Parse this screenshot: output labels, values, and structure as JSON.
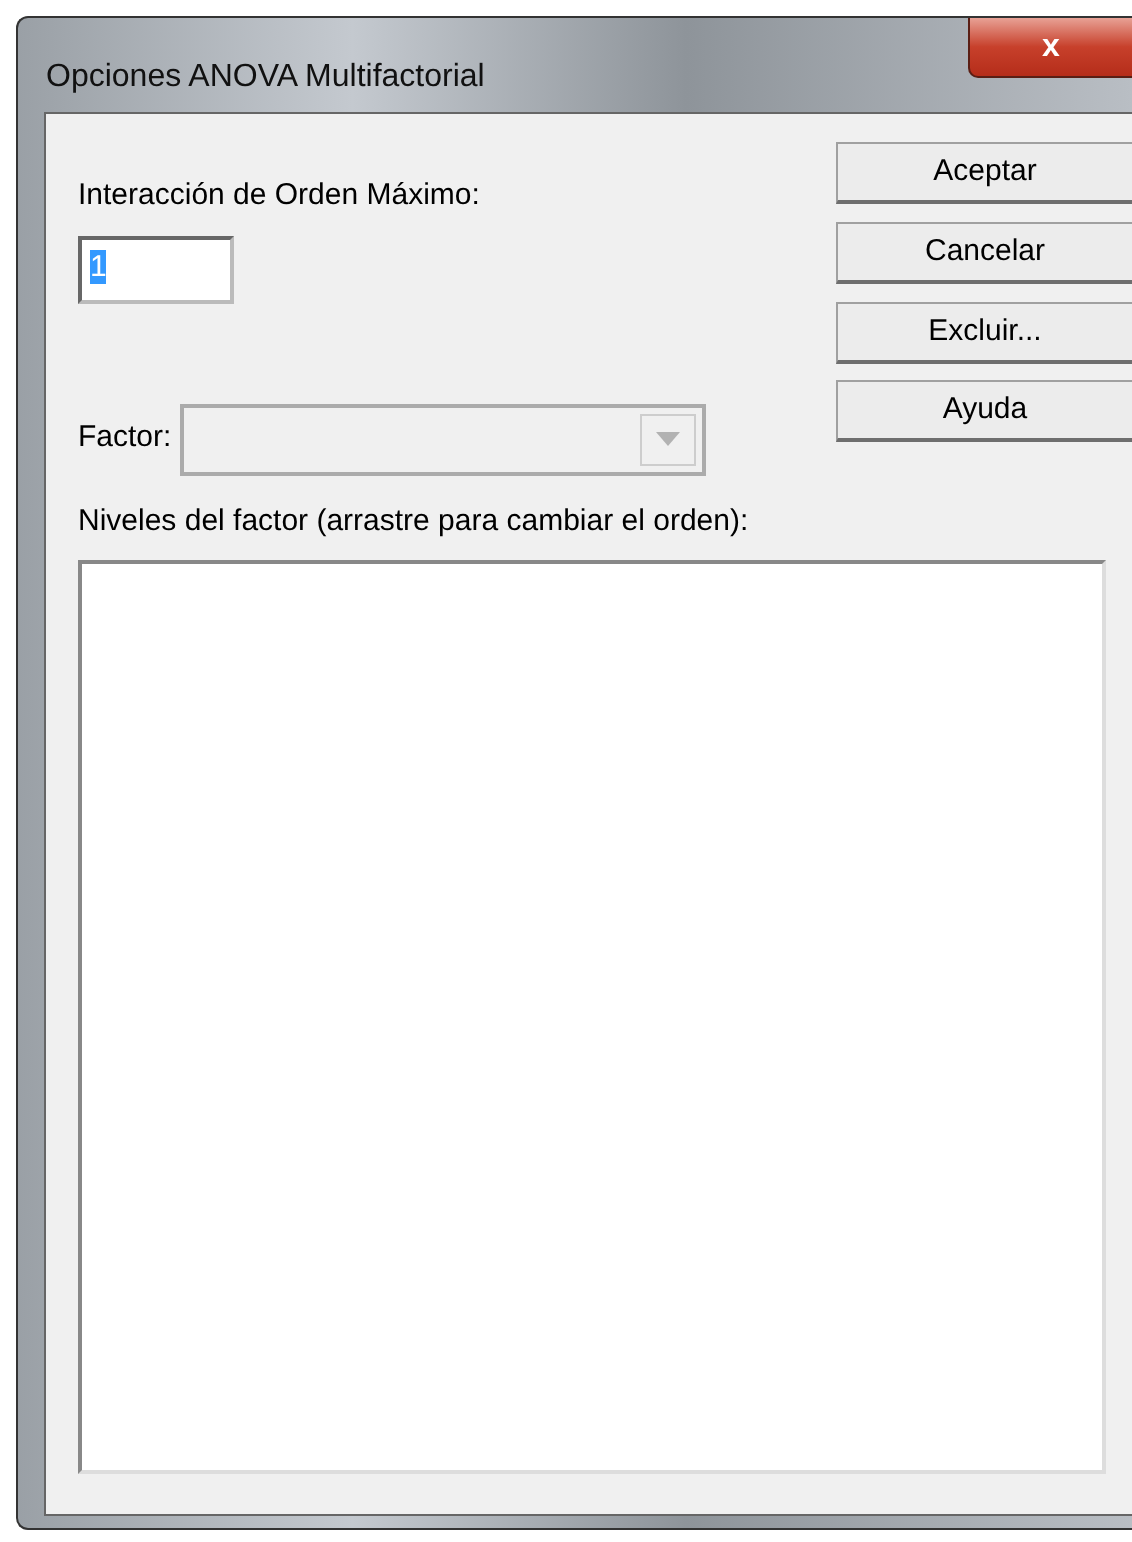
{
  "window": {
    "title": "Opciones ANOVA Multifactorial",
    "close_label": "x"
  },
  "max_order": {
    "label": "Interacción de Orden Máximo:",
    "value": "1"
  },
  "factor": {
    "label": "Factor:",
    "disabled": true
  },
  "levels": {
    "label": "Niveles del factor (arrastre para cambiar el orden):"
  },
  "buttons": [
    "Aceptar",
    "Cancelar",
    "Excluir...",
    "Ayuda"
  ]
}
